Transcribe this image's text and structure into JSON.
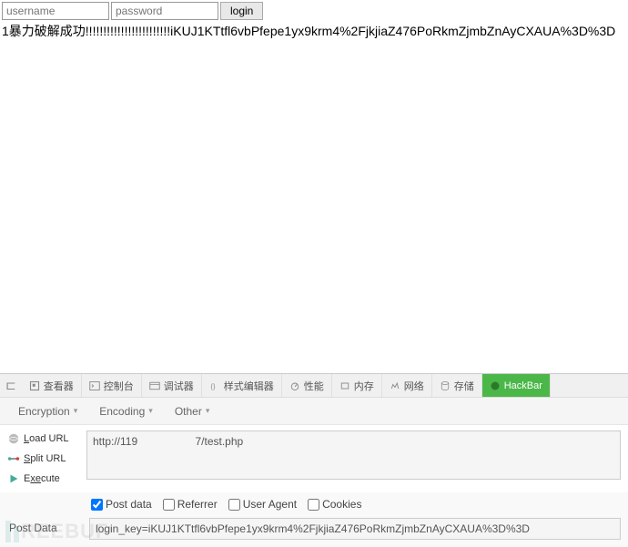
{
  "page": {
    "username_placeholder": "username",
    "password_placeholder": "password",
    "login_button": "login",
    "result": "1暴力破解成功!!!!!!!!!!!!!!!!!!!!!!!!iKUJ1KTtfl6vbPfepe1yx9krm4%2FjkjiaZ476PoRkmZjmbZnAyCXAUA%3D%3D"
  },
  "devtools": {
    "tabs": {
      "inspector": "查看器",
      "console": "控制台",
      "debugger": "调试器",
      "style": "样式编辑器",
      "performance": "性能",
      "memory": "内存",
      "network": "网络",
      "storage": "存储",
      "hackbar": "HackBar"
    },
    "dropdowns": {
      "encryption": "Encryption",
      "encoding": "Encoding",
      "other": "Other"
    },
    "side": {
      "load_url": "oad URL",
      "load_url_u": "L",
      "split_url": "plit URL",
      "split_url_u": "S",
      "execute": "cute",
      "execute_u": "xe",
      "execute_pre": "E"
    },
    "url_value": "http://119                   7/test.php",
    "checkboxes": {
      "postdata": "Post data",
      "referrer": "Referrer",
      "useragent": "User Agent",
      "cookies": "Cookies"
    },
    "postdata_label": "Post Data",
    "postdata_value": "login_key=iKUJ1KTtfl6vbPfepe1yx9krm4%2FjkjiaZ476PoRkmZjmbZnAyCXAUA%3D%3D"
  },
  "watermark": "REEBUF"
}
